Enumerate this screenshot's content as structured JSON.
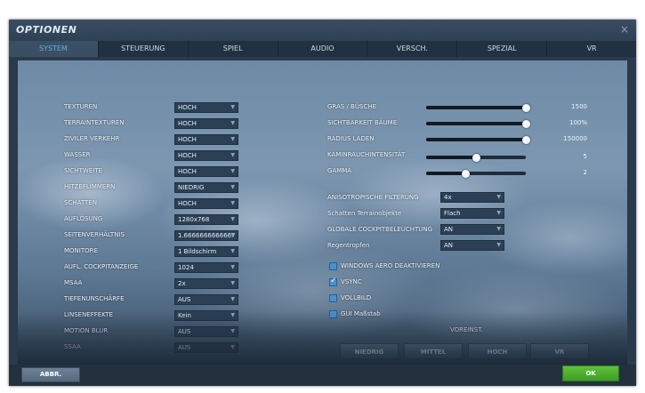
{
  "window": {
    "title": "OPTIONEN",
    "close": "×"
  },
  "tabs": [
    {
      "label": "SYSTEM",
      "active": true
    },
    {
      "label": "STEUERUNG",
      "active": false
    },
    {
      "label": "SPIEL",
      "active": false
    },
    {
      "label": "AUDIO",
      "active": false
    },
    {
      "label": "VERSCH.",
      "active": false
    },
    {
      "label": "SPEZIAL",
      "active": false
    },
    {
      "label": "VR",
      "active": false
    }
  ],
  "left_settings": [
    {
      "label": "TEXTUREN",
      "value": "HOCH"
    },
    {
      "label": "TERRAINTEXTUREN",
      "value": "HOCH"
    },
    {
      "label": "ZIVILER VERKEHR",
      "value": "HOCH"
    },
    {
      "label": "WASSER",
      "value": "HOCH"
    },
    {
      "label": "SICHTWEITE",
      "value": "HOCH"
    },
    {
      "label": "HITZEFLIMMERN",
      "value": "NIEDRIG"
    },
    {
      "label": "SCHATTEN",
      "value": "HOCH"
    },
    {
      "label": "AUFLÖSUNG",
      "value": "1280x768"
    },
    {
      "label": "SEITENVERHÄLTNIS",
      "value": "1.6666666666667"
    },
    {
      "label": "MONITORE",
      "value": "1 Bildschirm"
    },
    {
      "label": "AUFL. COCKPITANZEIGE",
      "value": "1024"
    },
    {
      "label": "MSAA",
      "value": "2x"
    },
    {
      "label": "TIEFENUNSCHÄRFE",
      "value": "AUS"
    },
    {
      "label": "LINSENEFFEKTE",
      "value": "Kein"
    },
    {
      "label": "MOTION BLUR",
      "value": "AUS"
    },
    {
      "label": "SSAA",
      "value": "AUS"
    }
  ],
  "sliders": [
    {
      "label": "GRAS / BÜSCHE",
      "value": "1500",
      "level": 1.0
    },
    {
      "label": "SICHTBARKEIT BÄUME",
      "value": "100%",
      "level": 1.0
    },
    {
      "label": "RADIUS LADEN",
      "value": "150000",
      "level": 1.0
    },
    {
      "label": "KAMINRAUCHINTENSITÄT",
      "value": "5",
      "level": 0.5
    },
    {
      "label": "GAMMA",
      "value": "2",
      "level": 0.4
    }
  ],
  "right_dropdowns": [
    {
      "label": "ANISOTROPISCHE FILTERUNG",
      "value": "4x"
    },
    {
      "label": "Schatten Terrainobjekte",
      "value": "Flach"
    },
    {
      "label": "GLOBALE COCKPITBELEUCHTUNG",
      "value": "AN"
    },
    {
      "label": "Regentropfen",
      "value": "AN"
    }
  ],
  "checkboxes": [
    {
      "label": "WINDOWS AERO DEAKTIVIEREN",
      "checked": false
    },
    {
      "label": "VSYNC",
      "checked": true
    },
    {
      "label": "VOLLBILD",
      "checked": false
    },
    {
      "label": "GUI Maßstab",
      "checked": false
    }
  ],
  "presets": {
    "title": "VOREINST.",
    "buttons": [
      "NIEDRIG",
      "MITTEL",
      "HOCH",
      "VR"
    ]
  },
  "footer": {
    "cancel": "ABBR.",
    "ok": "OK"
  },
  "colors": {
    "active_tab": "#5ab3e6",
    "ok_button": "#4aa82c",
    "checkbox": "#4a8fd2"
  }
}
